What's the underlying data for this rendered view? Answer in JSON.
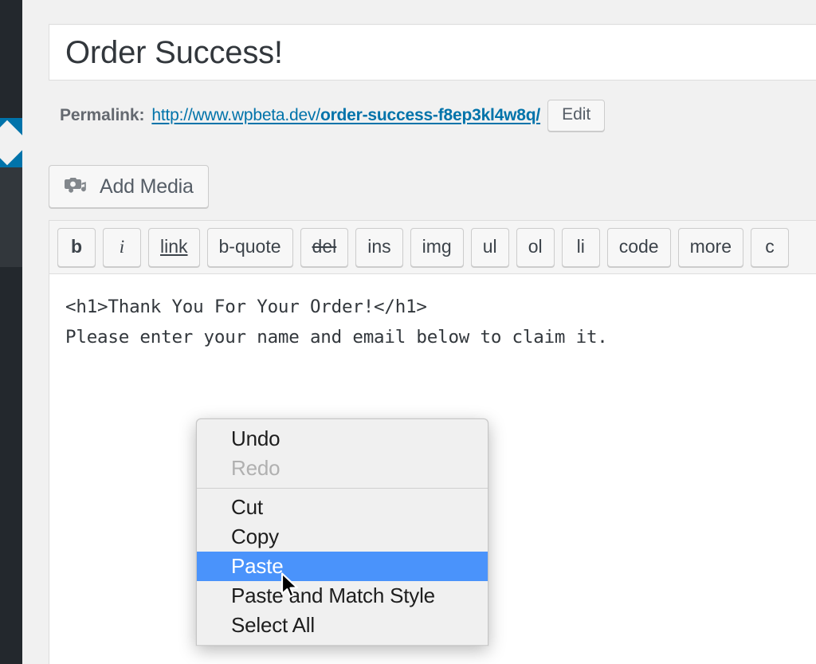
{
  "colors": {
    "admin_blue": "#0073aa",
    "sidebar_dark": "#23282d",
    "sidebar_mid": "#32373c",
    "page_bg": "#f1f1f1",
    "link": "#0073aa",
    "menu_highlight": "#4a93fb",
    "menu_bg": "#f0f0f0"
  },
  "sidebar": {
    "items": [
      {
        "name": "menu-segment-top",
        "state": "default"
      },
      {
        "name": "menu-segment-active",
        "state": "active"
      },
      {
        "name": "menu-segment-middle",
        "state": "default"
      },
      {
        "name": "menu-segment-bottom",
        "state": "default"
      }
    ]
  },
  "title": {
    "value": "Order Success!",
    "placeholder": "Enter title here"
  },
  "permalink": {
    "label": "Permalink:",
    "base_url": "http://www.wpbeta.dev/",
    "slug": "order-success-f8ep3kl4w8q/",
    "edit_label": "Edit"
  },
  "media": {
    "add_label": "Add Media",
    "icon": "add-media-icon"
  },
  "editor": {
    "toolbar": [
      {
        "label": "b",
        "style": "b",
        "name": "bold"
      },
      {
        "label": "i",
        "style": "i",
        "name": "italic"
      },
      {
        "label": "link",
        "style": "link",
        "name": "link"
      },
      {
        "label": "b-quote",
        "style": "",
        "name": "blockquote"
      },
      {
        "label": "del",
        "style": "del",
        "name": "del"
      },
      {
        "label": "ins",
        "style": "",
        "name": "ins"
      },
      {
        "label": "img",
        "style": "",
        "name": "img"
      },
      {
        "label": "ul",
        "style": "",
        "name": "ul"
      },
      {
        "label": "ol",
        "style": "",
        "name": "ol"
      },
      {
        "label": "li",
        "style": "",
        "name": "li"
      },
      {
        "label": "code",
        "style": "",
        "name": "code"
      },
      {
        "label": "more",
        "style": "",
        "name": "more"
      },
      {
        "label": "c",
        "style": "",
        "name": "close-tags"
      }
    ],
    "lines": [
      "<h1>Thank You For Your Order!</h1>",
      "Please enter your name and email below to claim it."
    ]
  },
  "context_menu": {
    "items": [
      {
        "label": "Undo",
        "state": "enabled",
        "name": "undo"
      },
      {
        "label": "Redo",
        "state": "disabled",
        "name": "redo"
      },
      {
        "label": "Cut",
        "state": "enabled",
        "name": "cut"
      },
      {
        "label": "Copy",
        "state": "enabled",
        "name": "copy"
      },
      {
        "label": "Paste",
        "state": "selected",
        "name": "paste"
      },
      {
        "label": "Paste and Match Style",
        "state": "enabled",
        "name": "paste-and-match-style"
      },
      {
        "label": "Select All",
        "state": "enabled",
        "name": "select-all"
      }
    ]
  }
}
